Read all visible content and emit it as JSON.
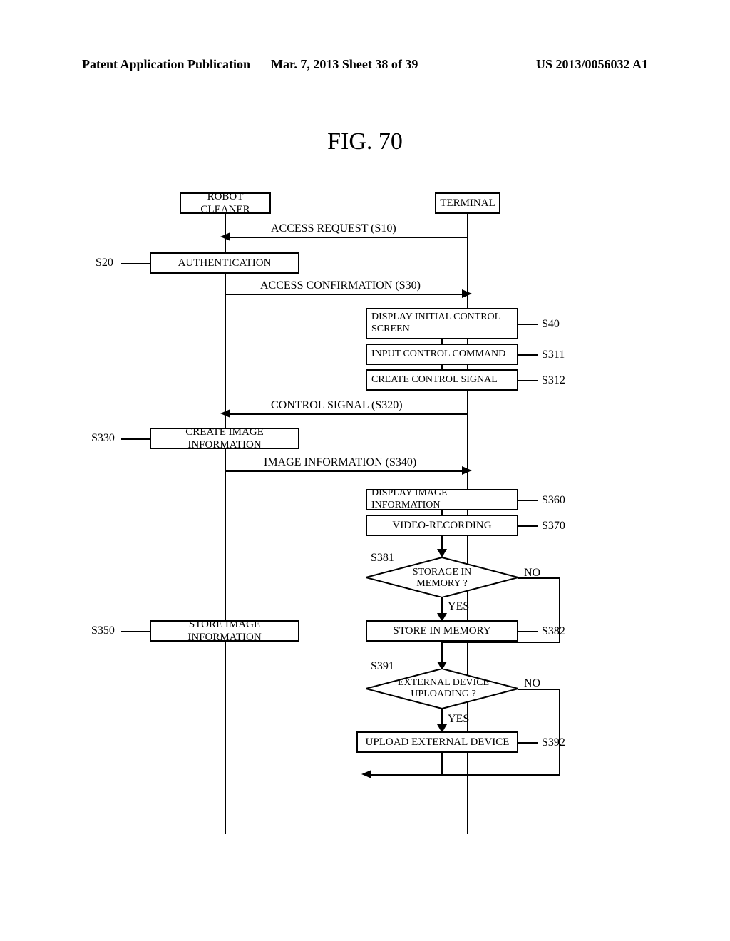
{
  "header": {
    "left": "Patent Application Publication",
    "center": "Mar. 7, 2013  Sheet 38 of 39",
    "right": "US 2013/0056032 A1"
  },
  "figure": {
    "title": "FIG.  70"
  },
  "actors": {
    "robot": "ROBOT CLEANER",
    "terminal": "TERMINAL"
  },
  "msgs": {
    "s10": "ACCESS REQUEST (S10)",
    "s30": "ACCESS CONFIRMATION (S30)",
    "s320": "CONTROL SIGNAL (S320)",
    "s340": "IMAGE INFORMATION (S340)"
  },
  "steps": {
    "s20": {
      "ref": "S20",
      "label": "AUTHENTICATION"
    },
    "s40": {
      "ref": "S40",
      "label": "DISPLAY INITIAL CONTROL SCREEN"
    },
    "s311": {
      "ref": "S311",
      "label": "INPUT CONTROL COMMAND"
    },
    "s312": {
      "ref": "S312",
      "label": "CREATE CONTROL SIGNAL"
    },
    "s330": {
      "ref": "S330",
      "label": "CREATE IMAGE INFORMATION"
    },
    "s350": {
      "ref": "S350",
      "label": "STORE IMAGE INFORMATION"
    },
    "s360": {
      "ref": "S360",
      "label": "DISPLAY IMAGE INFORMATION"
    },
    "s370": {
      "ref": "S370",
      "label": "VIDEO-RECORDING"
    },
    "s381": {
      "ref": "S381",
      "label": "STORAGE IN MEMORY ?"
    },
    "s382": {
      "ref": "S382",
      "label": "STORE IN MEMORY"
    },
    "s391": {
      "ref": "S391",
      "label": "EXTERNAL DEVICE UPLOADING ?"
    },
    "s392": {
      "ref": "S392",
      "label": "UPLOAD EXTERNAL DEVICE"
    }
  },
  "branch": {
    "yes": "YES",
    "no": "NO"
  }
}
